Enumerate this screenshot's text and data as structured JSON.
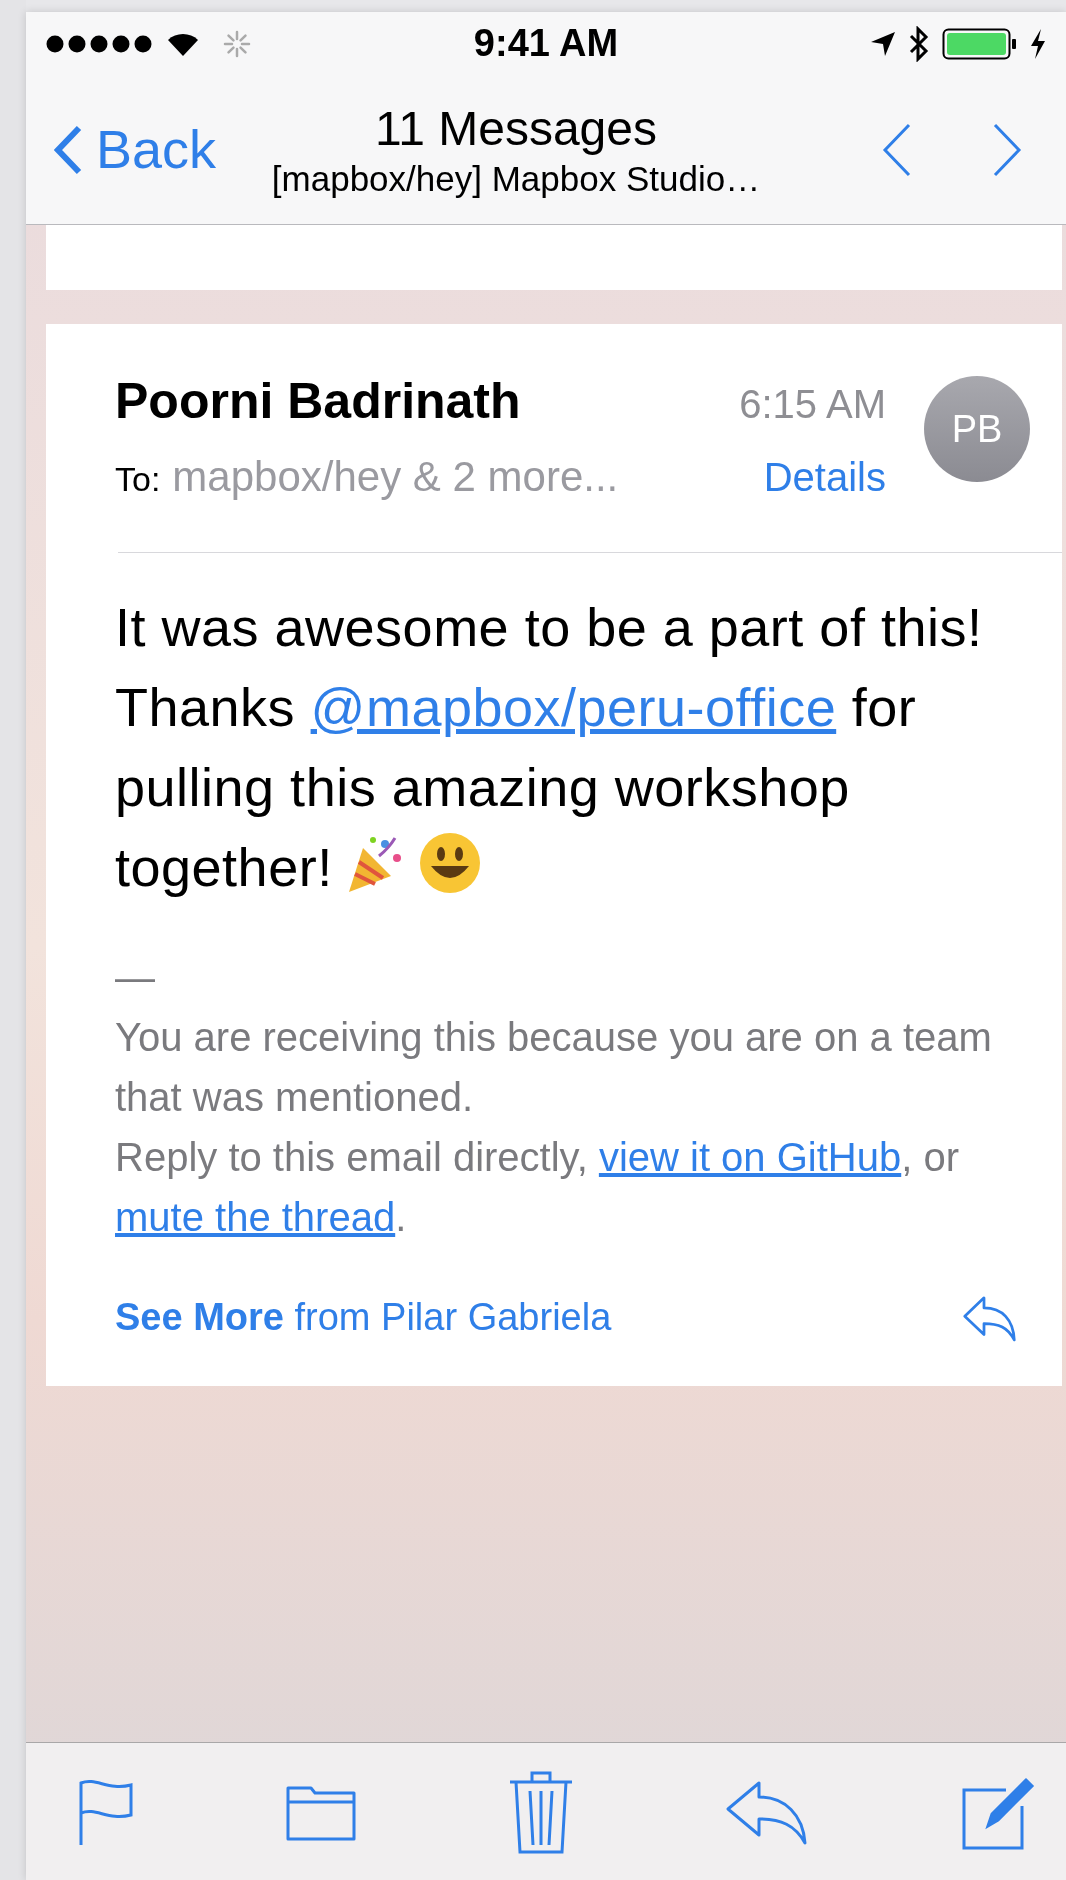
{
  "status_bar": {
    "time": "9:41 AM"
  },
  "nav": {
    "back": "Back",
    "title": "11 Messages",
    "subtitle": "[mapbox/hey] Mapbox Studio…"
  },
  "message": {
    "sender": "Poorni Badrinath",
    "time": "6:15 AM",
    "to_label": "To:",
    "recipients": "mapbox/hey & 2 more...",
    "details": "Details",
    "avatar": "PB",
    "body": [
      {
        "kind": "text",
        "text": "It was awesome to be a part of this! Thanks "
      },
      {
        "kind": "link",
        "text": "@mapbox/peru-office"
      },
      {
        "kind": "text",
        "text": " for pulling this amazing workshop together!"
      }
    ],
    "separator": "—",
    "notice": "You are receiving this because you are on a team that was mentioned.",
    "reply_line": [
      {
        "kind": "text",
        "text": "Reply to this email directly, "
      },
      {
        "kind": "link",
        "text": "view it on GitHub"
      },
      {
        "kind": "text",
        "text": ", or "
      },
      {
        "kind": "link",
        "text": "mute the thread"
      },
      {
        "kind": "text",
        "text": "."
      }
    ],
    "see_more": "**See More** from Pilar Gabriela"
  }
}
